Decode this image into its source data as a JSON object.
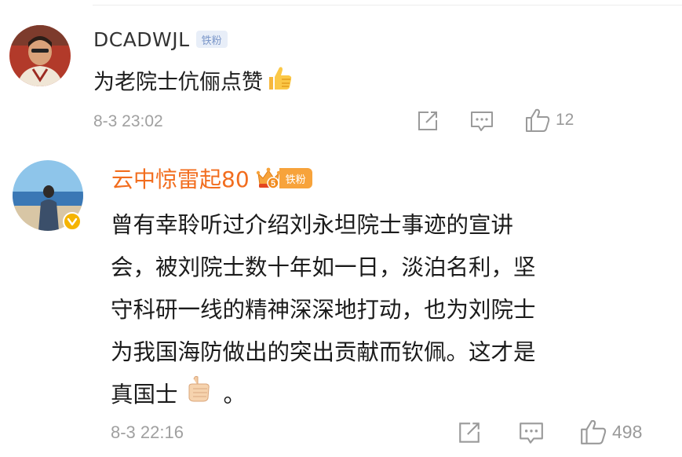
{
  "comments": [
    {
      "username": "DCADWJL",
      "badge": "铁粉",
      "text_before_emoji": "为老院士伉俪点赞",
      "text_after_emoji": "",
      "emoji": "thumbs-up",
      "timestamp": "8-3 23:02",
      "like_count": "12",
      "username_color": "#333333",
      "verified": false
    },
    {
      "username": "云中惊雷起80",
      "badge": "铁粉",
      "crown_level": "5",
      "text_lines": [
        "曾有幸聆听过介绍刘永坦院士事迹的宣讲",
        "会，被刘院士数十年如一日，淡泊名利，坚",
        "守科研一线的精神深深地打动，也为刘院士",
        "为我国海防做出的突出贡献而钦佩。这才是"
      ],
      "last_line_before_emoji": "真国士",
      "last_line_after_emoji": "。",
      "emoji": "thumbs-up",
      "timestamp": "8-3 22:16",
      "like_count": "498",
      "username_color": "#f26d1e",
      "verified": true
    }
  ],
  "icons": {
    "share": "share-icon",
    "comment": "comment-icon",
    "like": "like-icon"
  },
  "colors": {
    "meta_gray": "#a0a0a0",
    "badge_blue": "#7b97c9",
    "badge_orange": "#f7a33b",
    "verified_gold": "#f5b400"
  }
}
